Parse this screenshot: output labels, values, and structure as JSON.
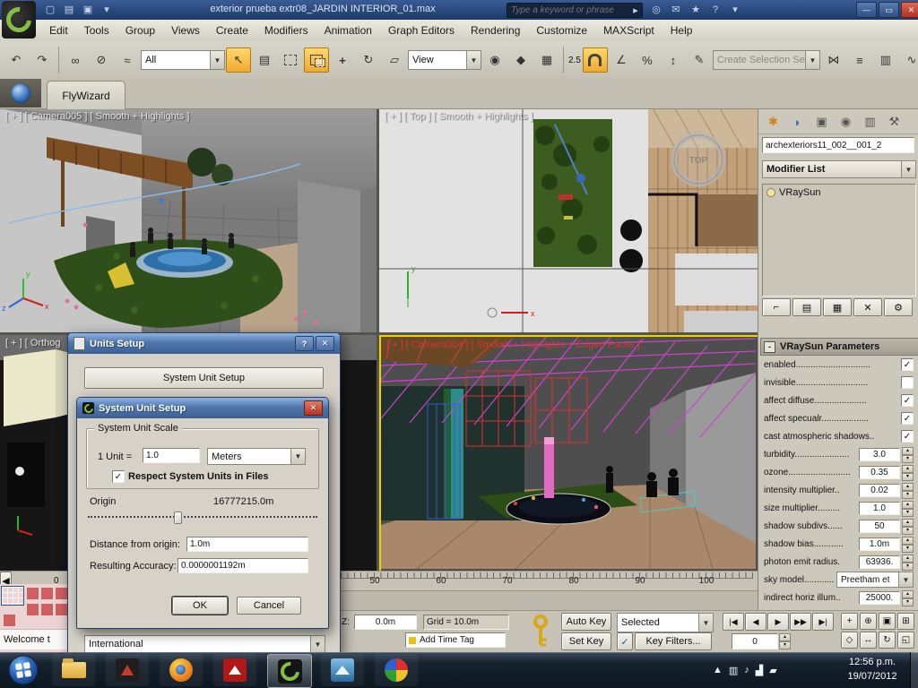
{
  "titlebar": {
    "title": "exterior prueba extr08_JARDIN INTERIOR_01.max",
    "search_placeholder": "Type a keyword or phrase"
  },
  "menu": {
    "items": [
      "Edit",
      "Tools",
      "Group",
      "Views",
      "Create",
      "Modifiers",
      "Animation",
      "Graph Editors",
      "Rendering",
      "Customize",
      "MAXScript",
      "Help"
    ]
  },
  "toolbar": {
    "selection_filter": "All",
    "reference_coordinate": "View",
    "snap_mode": "2.5",
    "named_selection": "Create Selection Se"
  },
  "tabs": {
    "fly_wizard": "FlyWizard"
  },
  "viewports": {
    "camera005_label": "[ + ] [ Camera005 ] [ Smooth + Highlights ]",
    "top_label": "[ + ] [ Top ] [ Smooth + Highlights ]",
    "ortho_label": "[ + ] [ Orthog",
    "camera004_label": "[ + ] [ Camera004 ] [ Smooth + Highlights + Edged Faces ]",
    "compass": {
      "label": "TOP"
    },
    "axis": {
      "x": "x",
      "y": "y",
      "z": "z"
    }
  },
  "command_panel": {
    "object_name": "archexteriors11_002__001_2",
    "modifier_list": "Modifier List",
    "stack": [
      "VRaySun"
    ],
    "rollout": {
      "state": "-",
      "title": "VRaySun Parameters"
    },
    "params": [
      {
        "label": "enabled..............................",
        "type": "check",
        "checked": true
      },
      {
        "label": "invisible.............................",
        "type": "check",
        "checked": false
      },
      {
        "label": "affect diffuse.....................",
        "type": "check",
        "checked": true
      },
      {
        "label": "affect specualr...................",
        "type": "check",
        "checked": true
      },
      {
        "label": "cast atmospheric shadows..",
        "type": "check",
        "checked": true
      },
      {
        "label": "turbidity......................",
        "type": "spin",
        "value": "3.0"
      },
      {
        "label": "ozone.........................",
        "type": "spin",
        "value": "0.35"
      },
      {
        "label": "intensity multiplier..",
        "type": "spin",
        "value": "0.02"
      },
      {
        "label": "size multiplier.........",
        "type": "spin",
        "value": "1.0"
      },
      {
        "label": "shadow subdivs......",
        "type": "spin",
        "value": "50"
      },
      {
        "label": "shadow bias............",
        "type": "spin",
        "value": "1.0m"
      },
      {
        "label": "photon emit radius.",
        "type": "spin",
        "value": "63936."
      },
      {
        "label": "sky model...............",
        "type": "drop",
        "value": "Preetham et"
      },
      {
        "label": "indirect horiz illum..",
        "type": "spin",
        "value": "25000."
      }
    ]
  },
  "units_dialog": {
    "title": "Units Setup",
    "help_glyph": "?",
    "system_unit_button": "System Unit Setup",
    "lighting_units": "International"
  },
  "system_unit_dialog": {
    "title": "System Unit Setup",
    "group": "System Unit Scale",
    "unit_label": "1 Unit =",
    "unit_value": "1.0",
    "unit_type": "Meters",
    "respect_label": "Respect System Units in Files",
    "respect_checked": true,
    "origin_label": "Origin",
    "origin_value": "16777215.0m",
    "distance_label": "Distance from origin:",
    "distance_value": "1.0m",
    "accuracy_label": "Resulting Accuracy:",
    "accuracy_value": "0.0000001192m",
    "ok": "OK",
    "cancel": "Cancel"
  },
  "timeline": {
    "ticks": [
      "50",
      "60",
      "70",
      "80",
      "90",
      "100"
    ],
    "start_frame": "0"
  },
  "status": {
    "z_label": "Z:",
    "z_value": "0.0m",
    "grid": "Grid = 10.0m",
    "add_time_tag": "Add Time Tag",
    "auto_key": "Auto Key",
    "set_key": "Set Key",
    "selection_mode": "Selected",
    "key_filters": "Key Filters...",
    "frame": "0"
  },
  "welcome_window": {
    "title": "Welcome t"
  },
  "taskbar": {
    "time": "12:56 p.m.",
    "date": "19/07/2012"
  }
}
